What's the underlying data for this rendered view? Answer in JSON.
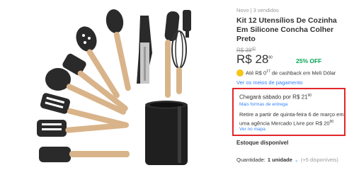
{
  "product": {
    "condition": "Novo",
    "sold": "3 vendidos",
    "title": "Kit 12 Utensílios De Cozinha Em Silicone Concha Colher Preto",
    "old_price_main": "R$ 38",
    "old_price_cents": "40",
    "price_currency": "R$ 28",
    "price_cents": "80",
    "discount": "25% OFF",
    "cashback_prefix": "Até R$ 0",
    "cashback_cents": "17",
    "cashback_suffix": "de cashback em Meli Dólar",
    "payment_link": "Ver os meios de pagamento"
  },
  "shipping": {
    "arrival_prefix": "Chegará sábado por R$ 21",
    "arrival_cents": "90",
    "shipping_link": "Mais formas de entrega",
    "pickup_prefix": "Retire a partir de quinta-feira 6 de março em uma agência Mercado Livre por R$ 20",
    "pickup_cents": "90",
    "map_link": "Ver no mapa"
  },
  "stock": {
    "label": "Estoque disponível",
    "qty_label": "Quantidade:",
    "qty_value": "1 unidade",
    "available": "(+5 disponíveis)"
  },
  "colors": {
    "accent": "#3483fa",
    "discount": "#00a650",
    "highlight_border": "#e3262b"
  }
}
